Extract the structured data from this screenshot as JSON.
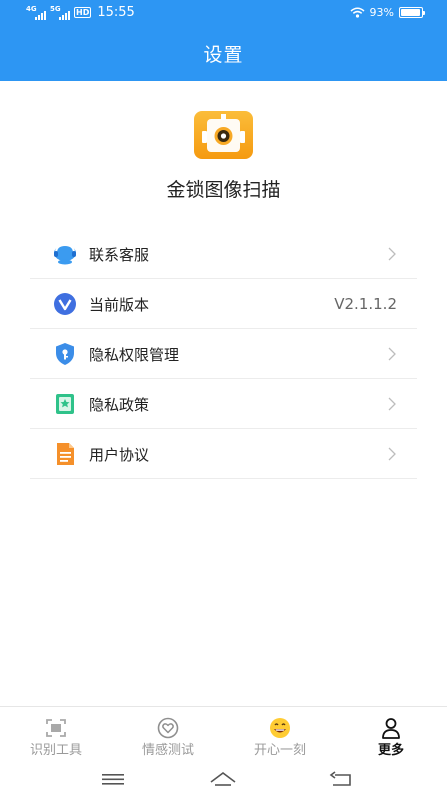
{
  "status_bar": {
    "network1": "4G",
    "network2": "5G",
    "hd": "HD",
    "time": "15:55",
    "battery_text": "93%",
    "battery_level": 0.93
  },
  "header": {
    "title": "设置"
  },
  "app": {
    "name": "金锁图像扫描",
    "logo_color": "#f8a925"
  },
  "settings": {
    "items": [
      {
        "label": "联系客服",
        "icon": "customer-service-icon"
      },
      {
        "label": "当前版本",
        "icon": "version-icon",
        "value": "V2.1.1.2"
      },
      {
        "label": "隐私权限管理",
        "icon": "privacy-shield-icon"
      },
      {
        "label": "隐私政策",
        "icon": "policy-bookmark-icon"
      },
      {
        "label": "用户协议",
        "icon": "document-icon"
      }
    ]
  },
  "bottom_nav": {
    "items": [
      {
        "label": "识别工具",
        "icon": "scan-icon"
      },
      {
        "label": "情感测试",
        "icon": "heart-icon"
      },
      {
        "label": "开心一刻",
        "icon": "smiley-icon"
      },
      {
        "label": "更多",
        "icon": "person-icon",
        "active": true
      }
    ]
  },
  "colors": {
    "header": "#2d96f3",
    "accent": "#2d96f3"
  }
}
